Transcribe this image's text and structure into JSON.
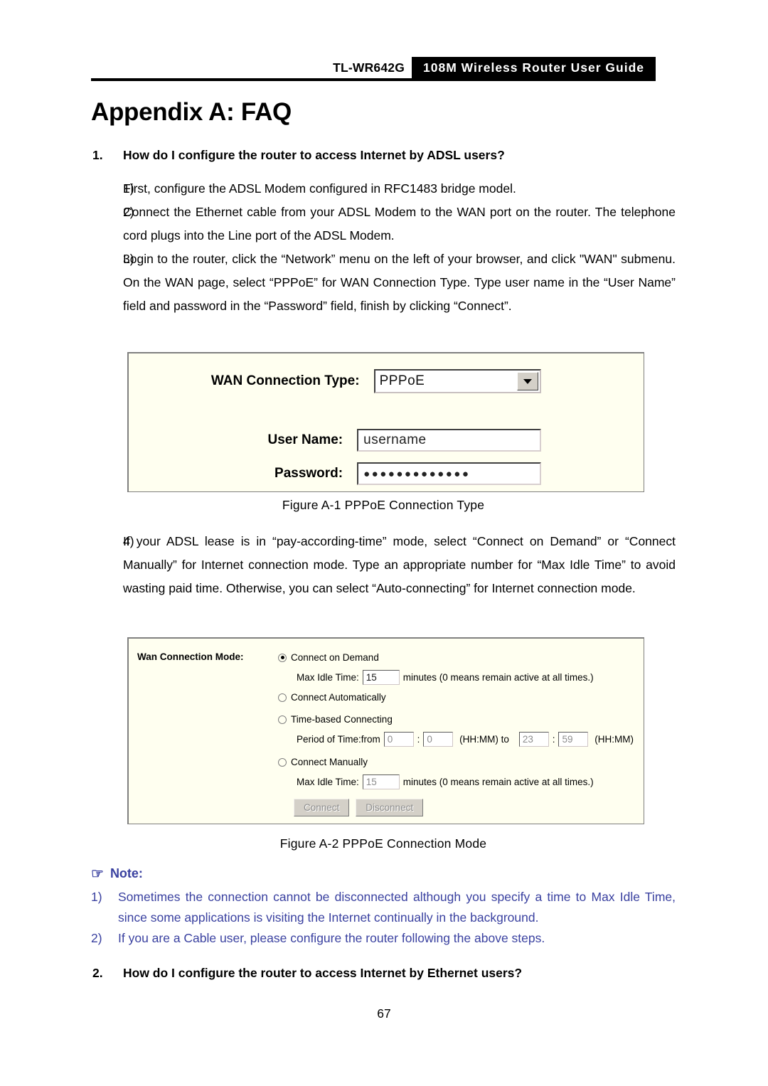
{
  "header": {
    "model": "TL-WR642G",
    "title": "108M Wireless Router User Guide"
  },
  "page_title": "Appendix A: FAQ",
  "questions": [
    {
      "number": "1.",
      "text": "How do I configure the router to access Internet by ADSL users?"
    },
    {
      "number": "2.",
      "text": "How do I configure the router to access Internet by Ethernet users?"
    }
  ],
  "steps": [
    {
      "number": "1)",
      "text": "First, configure the ADSL Modem configured in RFC1483 bridge model."
    },
    {
      "number": "2)",
      "text": "Connect the Ethernet cable from your ADSL Modem to the WAN port on the router. The telephone cord plugs into the Line port of the ADSL Modem."
    },
    {
      "number": "3)",
      "text": "Login to the router, click the “Network” menu on the left of your browser, and click \"WAN\" submenu. On the WAN page, select “PPPoE” for WAN Connection Type. Type user name in the “User Name” field and password in the “Password” field, finish by clicking “Connect”."
    },
    {
      "number": "4)",
      "text": "If your ADSL lease is in “pay-according-time” mode, select “Connect on Demand” or “Connect Manually” for Internet connection mode. Type an appropriate number for “Max Idle Time” to avoid wasting paid time. Otherwise, you can select “Auto-connecting” for Internet connection mode."
    }
  ],
  "figure1": {
    "caption": "Figure A-1   PPPoE Connection Type",
    "wan_type_label": "WAN Connection Type:",
    "wan_type_value": "PPPoE",
    "user_name_label": "User Name:",
    "user_name_value": "username",
    "password_label": "Password:",
    "password_value": "●●●●●●●●●●●●●",
    "dropdown_icon": "chevron-down-icon",
    "background_color": "#FFFFF0"
  },
  "figure2": {
    "caption": "Figure A-2   PPPoE Connection Mode",
    "mode_label": "Wan Connection Mode:",
    "options": [
      {
        "label": "Connect on Demand",
        "checked": true
      },
      {
        "label": "Connect Automatically",
        "checked": false
      },
      {
        "label": "Time-based Connecting",
        "checked": false
      },
      {
        "label": "Connect Manually",
        "checked": false
      }
    ],
    "max_idle_1": {
      "label": "Max Idle Time:",
      "value": "15",
      "suffix": "minutes (0 means remain active at all times.)"
    },
    "period": {
      "label": "Period of Time:from",
      "from_hh": "0",
      "from_mm": "0",
      "sep": ":",
      "fmt1": "(HH:MM) to",
      "to_hh": "23",
      "to_mm": "59",
      "fmt2": "(HH:MM)"
    },
    "max_idle_2": {
      "label": "Max Idle Time:",
      "value": "15",
      "suffix": "minutes (0 means remain active at all times.)"
    },
    "buttons": [
      {
        "label": "Connect"
      },
      {
        "label": "Disconnect"
      }
    ],
    "background_color": "#FFFFF0"
  },
  "note": {
    "icon": "pointing-hand-icon",
    "icon_glyph": "☞",
    "heading": "Note:",
    "color": "#3a41a0",
    "items": [
      {
        "number": "1)",
        "text": "Sometimes the connection cannot be disconnected although you specify a time to Max Idle Time, since some applications is visiting the Internet continually in the background."
      },
      {
        "number": "2)",
        "text": "If you are a Cable user, please configure the router following the above steps."
      }
    ]
  },
  "footer": {
    "page_number": "67"
  }
}
